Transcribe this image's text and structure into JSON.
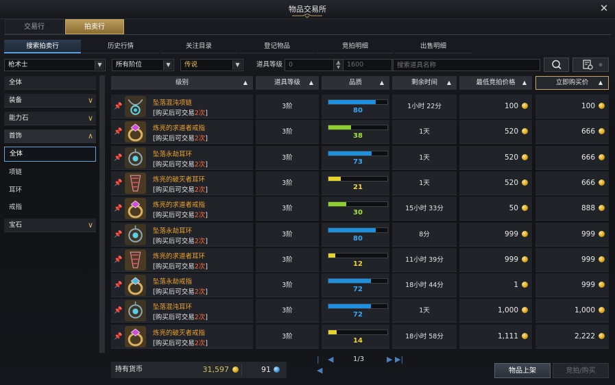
{
  "window": {
    "title": "物品交易所"
  },
  "main_tabs": [
    "交易行",
    "拍卖行"
  ],
  "sub_tabs": [
    "搜索拍卖行",
    "历史行情",
    "关注目录",
    "登记物品",
    "竞拍明细",
    "出售明细"
  ],
  "filters": {
    "class": "枪术士",
    "tier": "所有阶位",
    "grade": "传说",
    "level_label": "道具等级",
    "level_min": "0",
    "level_max": "1600",
    "tilde": "~",
    "search_placeholder": "搜索道具名称"
  },
  "categories": {
    "all": "全体",
    "equipment": "装备",
    "ability_stone": "能力石",
    "accessory": "首饰",
    "accessory_sub": [
      "全体",
      "项链",
      "耳环",
      "戒指"
    ],
    "gem": "宝石"
  },
  "table": {
    "headers": [
      "级别",
      "道具等级",
      "品质",
      "剩余时间",
      "最低竞拍价格",
      "立即购买价"
    ],
    "rows": [
      {
        "name": "坠落混沌项链",
        "note_prefix": "[购买后可交易",
        "note_count": "2次",
        "note_suffix": "]",
        "tier": "3阶",
        "quality": 80,
        "time": "1小时 22分",
        "min_bid": "100",
        "buy_now": "100",
        "icon": "necklace",
        "qcolor": "#1e90e0"
      },
      {
        "name": "炼亮的求道者戒指",
        "note_prefix": "[购买后可交易",
        "note_count": "2次",
        "note_suffix": "]",
        "tier": "3阶",
        "quality": 38,
        "time": "1天",
        "min_bid": "520",
        "buy_now": "666",
        "icon": "ring-pink",
        "qcolor": "#8ed12a"
      },
      {
        "name": "坠落永劫耳环",
        "note_prefix": "[购买后可交易",
        "note_count": "2次",
        "note_suffix": "]",
        "tier": "3阶",
        "quality": 73,
        "time": "1天",
        "min_bid": "520",
        "buy_now": "666",
        "icon": "earring-blue",
        "qcolor": "#1e90e0"
      },
      {
        "name": "炼亮的破灭者耳环",
        "note_prefix": "[购买后可交易",
        "note_count": "2次",
        "note_suffix": "]",
        "tier": "3阶",
        "quality": 21,
        "time": "1天",
        "min_bid": "520",
        "buy_now": "666",
        "icon": "earring-pink",
        "qcolor": "#e7d22c"
      },
      {
        "name": "炼亮的求道者戒指",
        "note_prefix": "[购买后可交易",
        "note_count": "2次",
        "note_suffix": "]",
        "tier": "3阶",
        "quality": 30,
        "time": "15小时 33分",
        "min_bid": "50",
        "buy_now": "888",
        "icon": "ring-pink",
        "qcolor": "#8ed12a"
      },
      {
        "name": "坠落永劫耳环",
        "note_prefix": "[购买后可交易",
        "note_count": "2次",
        "note_suffix": "]",
        "tier": "3阶",
        "quality": 80,
        "time": "8分",
        "min_bid": "999",
        "buy_now": "999",
        "icon": "earring-blue",
        "qcolor": "#1e90e0"
      },
      {
        "name": "炼亮的求道者耳环",
        "note_prefix": "[购买后可交易",
        "note_count": "2次",
        "note_suffix": "]",
        "tier": "3阶",
        "quality": 12,
        "time": "11小时 39分",
        "min_bid": "999",
        "buy_now": "999",
        "icon": "earring-pink",
        "qcolor": "#e7d22c"
      },
      {
        "name": "坠落永劫戒指",
        "note_prefix": "[购买后可交易",
        "note_count": "2次",
        "note_suffix": "]",
        "tier": "3阶",
        "quality": 72,
        "time": "18小时 44分",
        "min_bid": "1",
        "buy_now": "999",
        "icon": "ring-blue",
        "qcolor": "#1e90e0"
      },
      {
        "name": "坠落混沌耳环",
        "note_prefix": "[购买后可交易",
        "note_count": "2次",
        "note_suffix": "]",
        "tier": "3阶",
        "quality": 72,
        "time": "1天",
        "min_bid": "1,000",
        "buy_now": "1,000",
        "icon": "earring-blue",
        "qcolor": "#1e90e0"
      },
      {
        "name": "炼亮的破灭者戒指",
        "note_prefix": "[购买后可交易",
        "note_count": "2次",
        "note_suffix": "]",
        "tier": "3阶",
        "quality": 14,
        "time": "18小时 58分",
        "min_bid": "1,111",
        "buy_now": "2,222",
        "icon": "ring-pink",
        "qcolor": "#e7d22c"
      }
    ]
  },
  "pagination": {
    "text": "1/3"
  },
  "currency": {
    "label": "持有货币",
    "gold": "31,597",
    "blue": "91"
  },
  "buttons": {
    "list_item": "物品上架",
    "bid_buy": "竞拍/购买"
  }
}
